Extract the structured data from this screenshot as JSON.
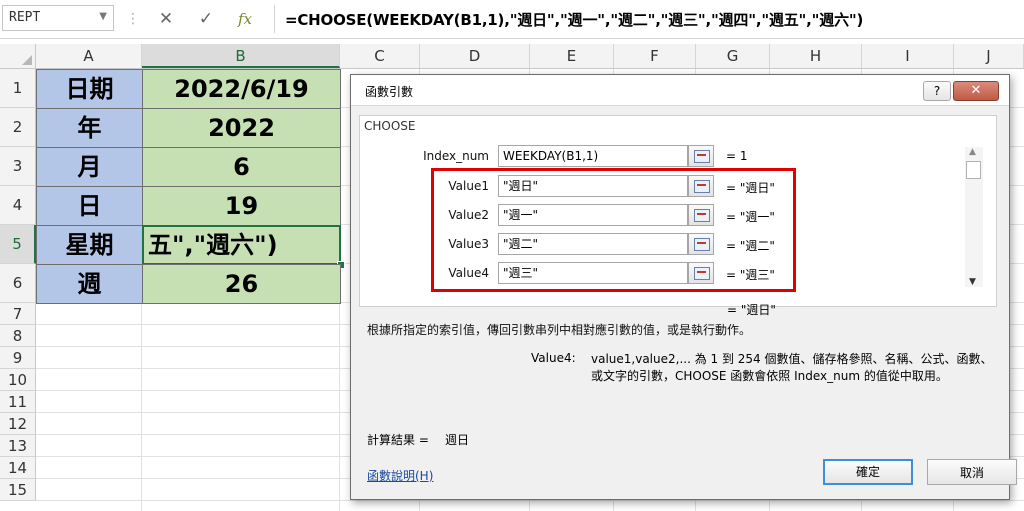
{
  "formula_bar": {
    "name_box": "REPT",
    "cancel_glyph": "✕",
    "enter_glyph": "✓",
    "fx": "fx",
    "formula": "=CHOOSE(WEEKDAY(B1,1),\"週日\",\"週一\",\"週二\",\"週三\",\"週四\",\"週五\",\"週六\")"
  },
  "columns": [
    "A",
    "B",
    "C",
    "D",
    "E",
    "F",
    "G",
    "H",
    "I",
    "J"
  ],
  "rows": [
    "1",
    "2",
    "3",
    "4",
    "5",
    "6",
    "7",
    "8",
    "9",
    "10",
    "11",
    "12",
    "13",
    "14",
    "15"
  ],
  "cells": {
    "a1": "日期",
    "b1": "2022/6/19",
    "a2": "年",
    "b2": "2022",
    "a3": "月",
    "b3": "6",
    "a4": "日",
    "b4": "19",
    "a5": "星期",
    "b5": "五\",\"週六\")",
    "a6": "週",
    "b6": "26"
  },
  "colors": {
    "col_a_fill": "#b4c6e7",
    "col_b_fill": "#c6e0b4",
    "selection": "#217346",
    "highlight_box": "#e00000"
  },
  "dialog": {
    "title": "函數引數",
    "help": "?",
    "close": "✕",
    "function_name": "CHOOSE",
    "args": [
      {
        "label": "Index_num",
        "value": "WEEKDAY(B1,1)",
        "result": "=  1"
      },
      {
        "label": "Value1",
        "value": "\"週日\"",
        "result": "=  \"週日\""
      },
      {
        "label": "Value2",
        "value": "\"週一\"",
        "result": "=  \"週一\""
      },
      {
        "label": "Value3",
        "value": "\"週二\"",
        "result": "=  \"週二\""
      },
      {
        "label": "Value4",
        "value": "\"週三\"",
        "result": "=  \"週三\""
      }
    ],
    "total_result": "=  \"週日\"",
    "description": "根據所指定的索引值，傳回引數串列中相對應引數的值，或是執行動作。",
    "arg_desc_name": "Value4:",
    "arg_desc_text": "value1,value2,... 為 1 到 254 個數值、儲存格參照、名稱、公式、函數、或文字的引數，CHOOSE 函數會依照 Index_num 的值從中取用。",
    "calc_label": "計算結果 =",
    "calc_value": "週日",
    "help_link": "函數說明(H)",
    "ok": "確定",
    "cancel": "取消"
  }
}
